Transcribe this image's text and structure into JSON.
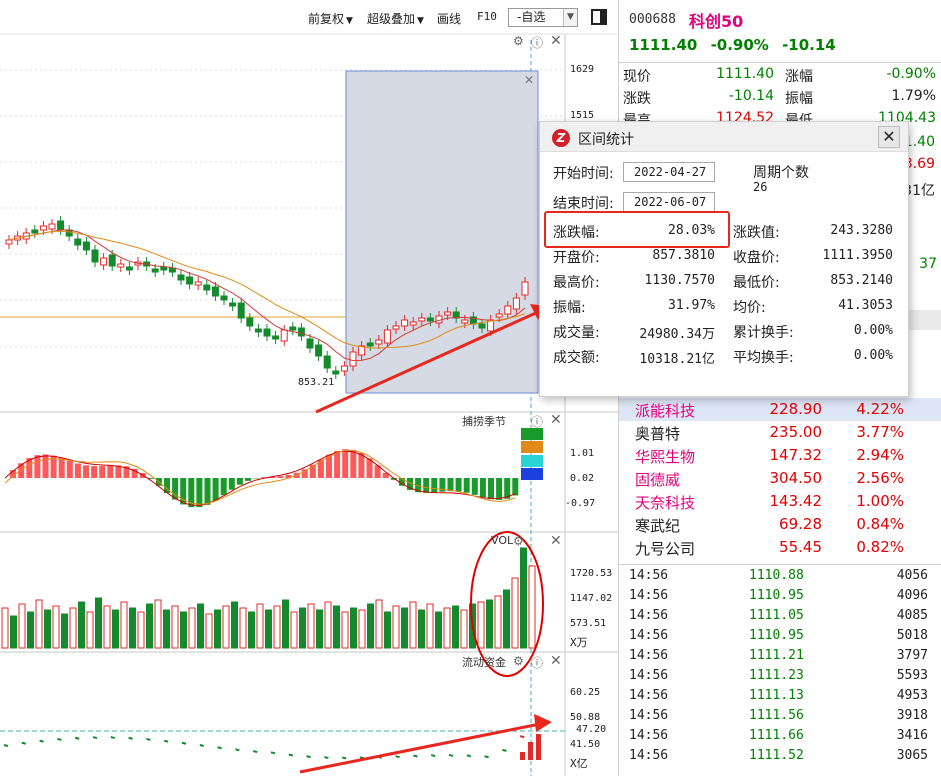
{
  "toolbar": {
    "restore_label": "前复权",
    "overlay_label": "超级叠加",
    "draw_label": "画线",
    "f10_label": "F10",
    "watchlist_label": "-自选"
  },
  "chart": {
    "price_low_label": "853.21",
    "price_axis": [
      "1629",
      "1515"
    ],
    "indicator_title": "捕捞季节",
    "indicator_axis": [
      "1.01",
      "0.02",
      "-0.97"
    ],
    "vol_title": "VOL",
    "vol_axis": [
      "1720.53",
      "1147.02",
      "573.51"
    ],
    "vol_unit": "X万",
    "flow_title": "流动资金",
    "flow_axis": [
      "60.25",
      "50.88",
      "47.20",
      "41.50"
    ],
    "flow_unit": "X亿",
    "colors": {
      "up": "#e02a2a",
      "down": "#138a2c",
      "selection": "#d6dbe6",
      "arrow": "#e8281f"
    }
  },
  "dialog": {
    "title": "区间统计",
    "start_label": "开始时间:",
    "start_value": "2022-04-27",
    "end_label": "结束时间:",
    "end_value": "2022-06-07",
    "period_label": "周期个数",
    "period_value": "26",
    "rows": [
      {
        "l1": "涨跌幅:",
        "v1": "28.03%",
        "l2": "涨跌值:",
        "v2": "243.3280"
      },
      {
        "l1": "开盘价:",
        "v1": "857.3810",
        "l2": "收盘价:",
        "v2": "1111.3950"
      },
      {
        "l1": "最高价:",
        "v1": "1130.7570",
        "l2": "最低价:",
        "v2": "853.2140"
      },
      {
        "l1": "振幅:",
        "v1": "31.97%",
        "l2": "均价:",
        "v2": "41.3053"
      },
      {
        "l1": "成交量:",
        "v1": "24980.34万",
        "l2": "累计换手:",
        "v2": "0.00%"
      },
      {
        "l1": "成交额:",
        "v1": "10318.21亿",
        "l2": "平均换手:",
        "v2": "0.00%"
      }
    ]
  },
  "quote": {
    "code": "000688",
    "name": "科创50",
    "price": "1111.40",
    "change_pct": "-0.90%",
    "change": "-10.14",
    "stats": [
      {
        "l1": "现价",
        "v1": "1111.40",
        "l2": "涨幅",
        "v2": "-0.90%"
      },
      {
        "l1": "涨跌",
        "v1": "-10.14",
        "l2": "振幅",
        "v2": "1.79%"
      },
      {
        "l1": "最高",
        "v1": "1124.52",
        "l2": "最低",
        "v2": "1104.43"
      }
    ],
    "partial_values": [
      "1.40",
      "3.69",
      "31亿",
      "37"
    ]
  },
  "constituents": [
    {
      "name": "派能科技",
      "price": "228.90",
      "pct": "4.22%"
    },
    {
      "name": "奥普特",
      "price": "235.00",
      "pct": "3.77%"
    },
    {
      "name": "华熙生物",
      "price": "147.32",
      "pct": "2.94%"
    },
    {
      "name": "固德威",
      "price": "304.50",
      "pct": "2.56%"
    },
    {
      "name": "天奈科技",
      "price": "143.42",
      "pct": "1.00%"
    },
    {
      "name": "寒武纪",
      "price": "69.28",
      "pct": "0.84%"
    },
    {
      "name": "九号公司",
      "price": "55.45",
      "pct": "0.82%"
    }
  ],
  "ticks": [
    {
      "time": "14:56",
      "price": "1110.88",
      "vol": "4056"
    },
    {
      "time": "14:56",
      "price": "1110.95",
      "vol": "4096"
    },
    {
      "time": "14:56",
      "price": "1111.05",
      "vol": "4085"
    },
    {
      "time": "14:56",
      "price": "1110.95",
      "vol": "5018"
    },
    {
      "time": "14:56",
      "price": "1111.21",
      "vol": "3797"
    },
    {
      "time": "14:56",
      "price": "1111.23",
      "vol": "5593"
    },
    {
      "time": "14:56",
      "price": "1111.13",
      "vol": "4953"
    },
    {
      "time": "14:56",
      "price": "1111.56",
      "vol": "3918"
    },
    {
      "time": "14:56",
      "price": "1111.66",
      "vol": "3416"
    },
    {
      "time": "14:56",
      "price": "1111.52",
      "vol": "3065"
    }
  ]
}
